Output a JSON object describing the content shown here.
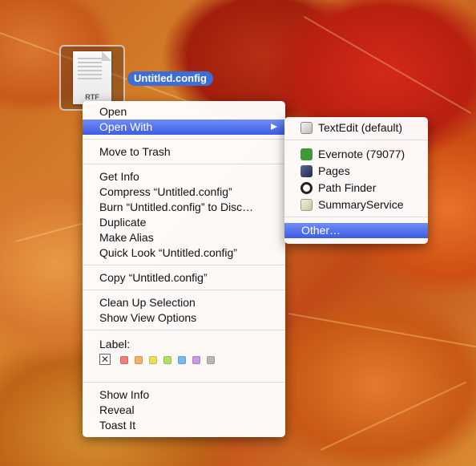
{
  "desktop": {
    "file_icon_ext": "RTF",
    "file_name": "Untitled.config"
  },
  "context_menu": {
    "open": "Open",
    "open_with": "Open With",
    "move_to_trash": "Move to Trash",
    "get_info": "Get Info",
    "compress": "Compress “Untitled.config”",
    "burn": "Burn “Untitled.config” to Disc…",
    "duplicate": "Duplicate",
    "make_alias": "Make Alias",
    "quick_look": "Quick Look “Untitled.config”",
    "copy": "Copy “Untitled.config”",
    "clean_up": "Clean Up Selection",
    "view_options": "Show View Options",
    "label": "Label:",
    "label_none_glyph": "✕",
    "label_colors": [
      "#f07c7c",
      "#f2b462",
      "#ecdc62",
      "#b4e062",
      "#7ab8f0",
      "#c69ae6",
      "#b8b8b8"
    ],
    "show_info": "Show Info",
    "reveal": "Reveal",
    "toast_it": "Toast It"
  },
  "open_with_submenu": {
    "textedit": "TextEdit (default)",
    "evernote": "Evernote (79077)",
    "pages": "Pages",
    "path_finder": "Path Finder",
    "summary_service": "SummaryService",
    "other": "Other…"
  },
  "highlight_color": "#3d5de6"
}
